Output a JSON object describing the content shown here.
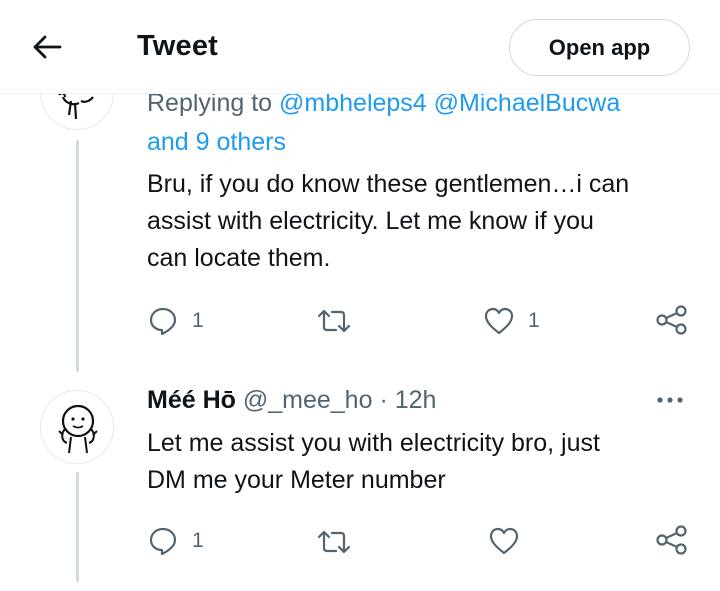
{
  "header": {
    "title": "Tweet",
    "open_app_label": "Open app"
  },
  "tweet1": {
    "replying_prefix": "Replying to ",
    "replying_mentions": "@mbheleps4 @MichaelBucwa",
    "replying_others": "and 9 others",
    "text_lines": [
      "Bru, if you do know these gentlemen…i can",
      "assist with electricity. Let me know if you",
      "can locate them."
    ],
    "actions": {
      "reply_count": "1",
      "retweet_count": "",
      "like_count": "1"
    }
  },
  "tweet2": {
    "display_name": "Méé Hō",
    "handle": "@_mee_ho",
    "separator": "·",
    "time": "12h",
    "text_lines": [
      "Let me assist you with electricity bro, just",
      "DM me your Meter number"
    ],
    "actions": {
      "reply_count": "1",
      "retweet_count": "",
      "like_count": ""
    }
  },
  "icons": {
    "back": "arrow-left-icon",
    "reply": "speech-bubble-icon",
    "retweet": "retweet-icon",
    "like": "heart-icon",
    "share": "share-nodes-icon",
    "more": "more-dots-icon"
  },
  "colors": {
    "link": "#1d9bf0",
    "secondary_text": "#536471",
    "primary_text": "#0f1419",
    "thread_line": "#cfd9de"
  }
}
